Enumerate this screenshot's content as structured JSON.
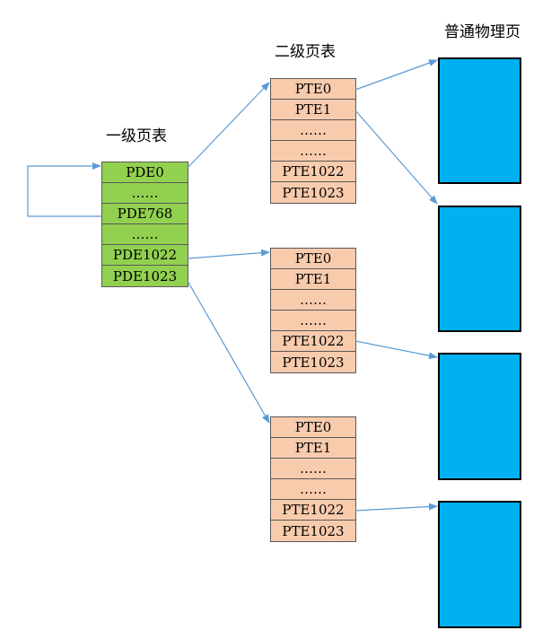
{
  "labels": {
    "level1": "一级页表",
    "level2": "二级页表",
    "physical": "普通物理页"
  },
  "page_directory": {
    "entries": [
      "PDE0",
      "……",
      "PDE768",
      "……",
      "PDE1022",
      "PDE1023"
    ]
  },
  "page_tables": [
    {
      "entries": [
        "PTE0",
        "PTE1",
        "……",
        "……",
        "PTE1022",
        "PTE1023"
      ]
    },
    {
      "entries": [
        "PTE0",
        "PTE1",
        "……",
        "……",
        "PTE1022",
        "PTE1023"
      ]
    },
    {
      "entries": [
        "PTE0",
        "PTE1",
        "……",
        "……",
        "PTE1022",
        "PTE1023"
      ]
    }
  ],
  "colors": {
    "pde_fill": "#92d050",
    "pte_fill": "#f8cbad",
    "page_fill": "#00b0f0",
    "arrow": "#5b9bd5"
  }
}
